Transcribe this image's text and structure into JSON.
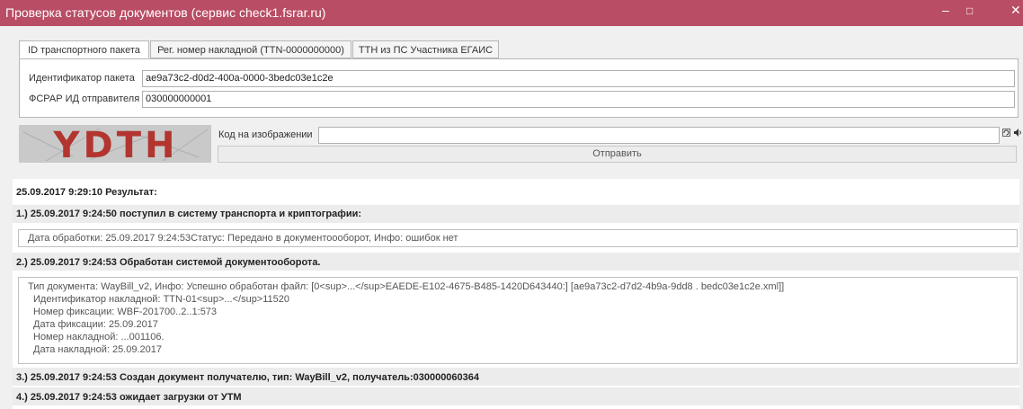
{
  "window": {
    "title": "Проверка статусов документов (сервис check1.fsrar.ru)",
    "minimize": "–",
    "maximize": "□",
    "close": "✕"
  },
  "tabs": [
    {
      "label": "ID транспортного пакета",
      "active": true
    },
    {
      "label": "Рег. номер накладной (TTN-0000000000)",
      "active": false
    },
    {
      "label": "ТТН из ПС Участника ЕГАИС",
      "active": false
    }
  ],
  "form": {
    "package_id_label": "Идентификатор пакета",
    "package_id_value": "ae9a73c2-d0d2-400a-0000-3bedc03e1c2e",
    "sender_label": "ФСРАР ИД отправителя",
    "sender_value": "030000000001"
  },
  "captcha": {
    "image_text": "YDTH",
    "label": "Код на изображении",
    "value": "",
    "refresh_icon": "refresh-icon",
    "audio_icon": "speaker-icon",
    "submit_label": "Отправить"
  },
  "results": {
    "header": "25.09.2017 9:29:10 Результат:",
    "step1": "1.) 25.09.2017 9:24:50 поступил в систему транспорта и криптографии:",
    "step1_detail": "Дата обработки: 25.09.2017 9:24:53Статус: Передано в документоооборот, Инфо: ошибок нет",
    "step2": "2.) 25.09.2017 9:24:53 Обработан системой документооборота.",
    "step2_lines": [
      "Тип документа: WayBill_v2, Инфо: Успешно обработан файл: [0<sup>...</sup>EAEDE-E102-4675-B485-1420D643440:] [ae9a73c2-d7d2-4b9a-9dd8 . bedc03e1c2e.xml]]",
      "Идентификатор накладной: TTN-01<sup>...</sup>11520",
      "Номер фиксации: WBF-201700..2..1:573",
      "Дата фиксации: 25.09.2017",
      "Номер накладной: ...001106.",
      "Дата накладной: 25.09.2017"
    ],
    "step3": "3.) 25.09.2017 9:24:53 Создан документ получателю, тип: WayBill_v2, получатель:030000060364",
    "step4": "4.) 25.09.2017 9:24:53 ожидает загрузки от УТМ"
  }
}
